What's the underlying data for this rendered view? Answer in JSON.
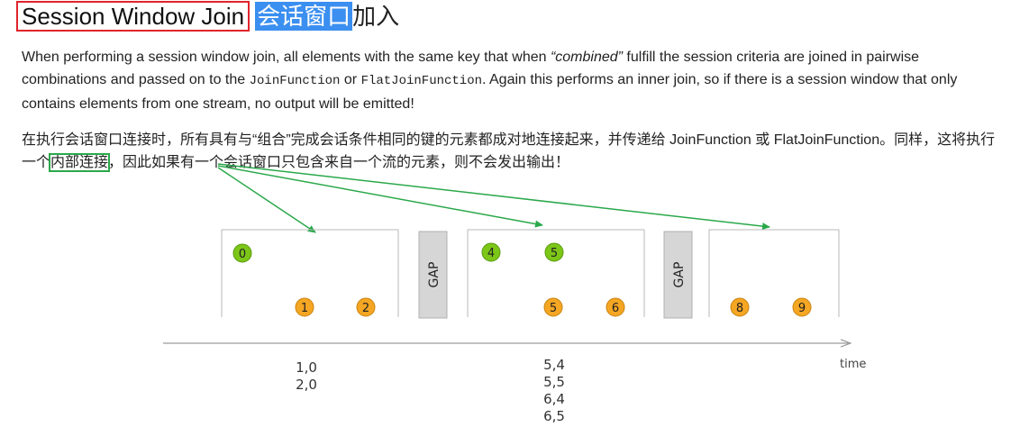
{
  "heading": {
    "title_en": "Session Window Join",
    "title_zh_selected": "会话窗口",
    "title_zh_rest": "加入"
  },
  "paragraph_en": {
    "part1": "When performing a session window join, all elements with the same key that when ",
    "emphasis": "“combined”",
    "part2": " fulfill the session criteria are joined in pairwise combinations and passed on to the ",
    "code1": "JoinFunction",
    "part3": " or ",
    "code2": "FlatJoinFunction",
    "part4": ". Again this performs an inner join, so if there is a session window that only contains elements from one stream, no output will be emitted!"
  },
  "paragraph_zh": {
    "part1": "在执行会话窗口连接时，所有具有与“组合”完成会话条件相同的键的元素都成对地连接起来，并传递给 JoinFunction 或 FlatJoinFunction。同样，这将执行一个",
    "boxed": "内部连接",
    "part2": "，因此如果有一个会话窗口只包含来自一个流的元素，则不会发出输出！"
  },
  "diagram": {
    "gap_label": "GAP",
    "time_label": "time",
    "colors": {
      "green": "#7cc618",
      "orange": "#f5a623",
      "annotation": "#2aa84a"
    },
    "windows": [
      {
        "green": [
          "0"
        ],
        "orange": [
          "1",
          "2"
        ],
        "output": [
          "1,0",
          "2,0"
        ]
      },
      {
        "green": [
          "4",
          "5"
        ],
        "orange": [
          "5",
          "6"
        ],
        "output": [
          "5,4",
          "5,5",
          "6,4",
          "6,5"
        ]
      },
      {
        "green": [],
        "orange": [
          "8",
          "9"
        ],
        "output": []
      }
    ]
  }
}
